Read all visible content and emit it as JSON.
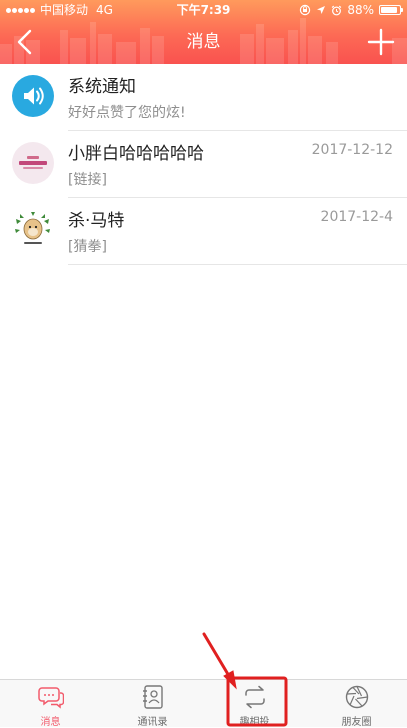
{
  "status_bar": {
    "carrier": "中国移动",
    "network": "4G",
    "time": "下午7:39",
    "battery": "88%",
    "battery_level": 0.88
  },
  "nav": {
    "title": "消息",
    "back_icon": "chevron-left-icon",
    "add_icon": "plus-icon"
  },
  "messages": [
    {
      "name": "系统通知",
      "preview": "好好点赞了您的炫!",
      "date": "",
      "avatar": "megaphone-icon",
      "avatar_color": "#29a9e0"
    },
    {
      "name": "小胖白哈哈哈哈哈",
      "preview": "[链接]",
      "date": "2017-12-12",
      "avatar": "pink-text-avatar",
      "avatar_color": "#f4e8ee"
    },
    {
      "name": "杀·马特",
      "preview": "[猜拳]",
      "date": "2017-12-4",
      "avatar": "hamster-avatar",
      "avatar_color": "#ffffff"
    }
  ],
  "tabs": [
    {
      "label": "消息",
      "icon": "chat-bubbles-icon",
      "active": true
    },
    {
      "label": "通讯录",
      "icon": "contacts-book-icon",
      "active": false
    },
    {
      "label": "趣相投",
      "icon": "swap-arrows-icon",
      "active": false
    },
    {
      "label": "朋友圈",
      "icon": "aperture-icon",
      "active": false
    }
  ],
  "colors": {
    "header_top": "#ff9a5c",
    "header_bottom": "#f9524f",
    "accent": "#f25a6b",
    "annotation": "#e02020"
  }
}
